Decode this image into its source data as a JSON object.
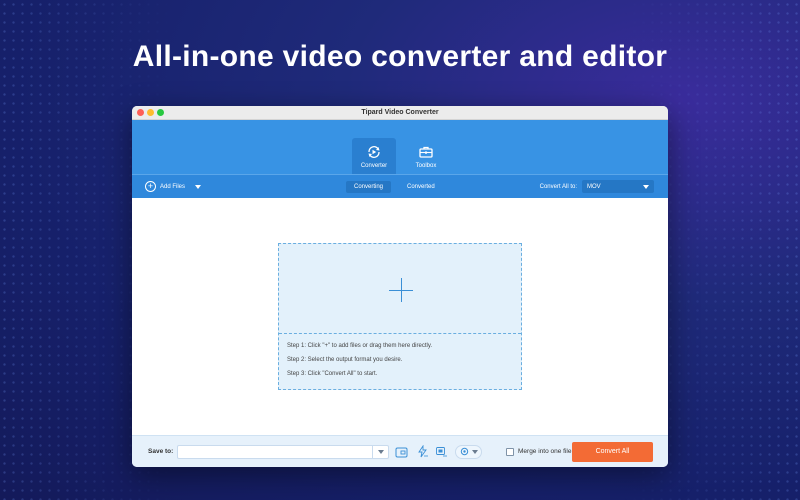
{
  "headline": "All-in-one video converter and editor",
  "window": {
    "title": "Tipard Video Converter"
  },
  "nav": {
    "tabs": [
      {
        "label": "Converter",
        "icon": "converter-icon",
        "active": true
      },
      {
        "label": "Toolbox",
        "icon": "toolbox-icon",
        "active": false
      }
    ]
  },
  "toolbar": {
    "add_files": "Add Files",
    "subtabs": [
      {
        "label": "Converting",
        "active": true
      },
      {
        "label": "Converted",
        "active": false
      }
    ],
    "convert_all_to_label": "Convert All to:",
    "format": "MOV"
  },
  "dropzone": {
    "plus": "+",
    "steps": [
      "Step 1: Click \"+\" to add files or drag them here directly.",
      "Step 2: Select the output format you desire.",
      "Step 3: Click \"Convert All\" to start."
    ]
  },
  "footer": {
    "save_to_label": "Save to:",
    "save_path": "",
    "merge_label": "Merge into one file",
    "convert_all_button": "Convert All"
  },
  "colors": {
    "nav_blue": "#3893e4",
    "toolbar_blue": "#2f88dc",
    "convert_orange": "#f36b35",
    "dropzone_bg": "#e3f1fb"
  }
}
